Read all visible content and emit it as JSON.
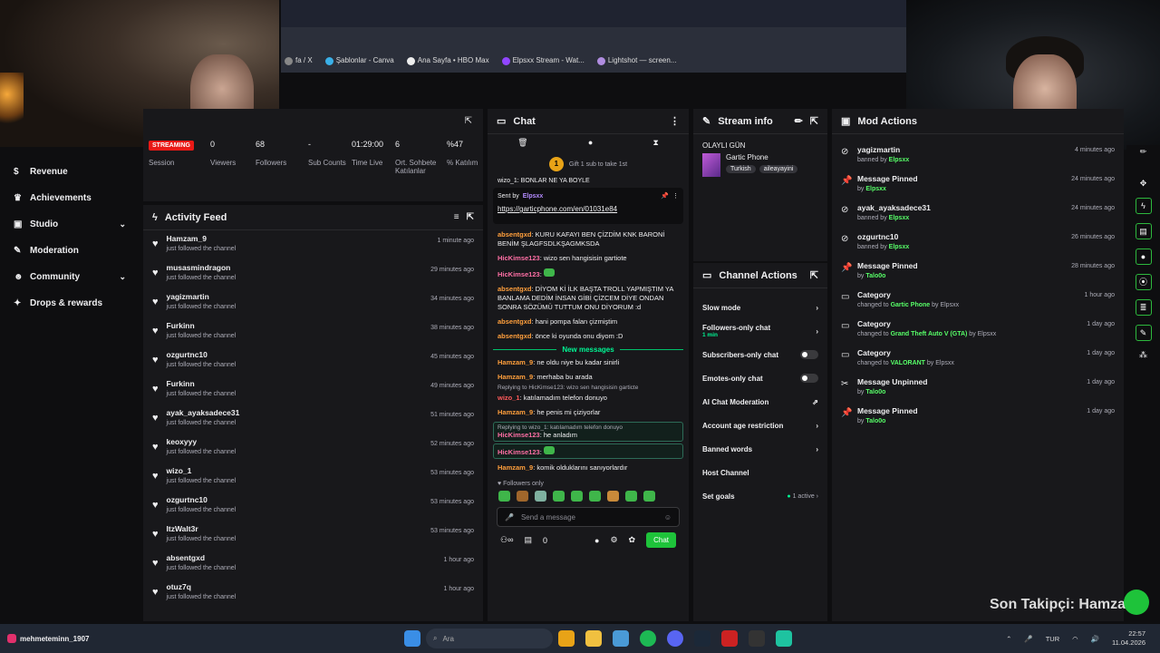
{
  "bookmarks": [
    {
      "label": "fa / X"
    },
    {
      "label": "Şablonlar - Canva"
    },
    {
      "label": "Ana Sayfa • HBO Max"
    },
    {
      "label": "Elpsxx Stream - Wat..."
    },
    {
      "label": "Lightshot — screen..."
    }
  ],
  "sidebar": {
    "items": [
      {
        "label": "Revenue",
        "icon": "dollar-icon",
        "chev": false
      },
      {
        "label": "Achievements",
        "icon": "trophy-icon",
        "chev": false
      },
      {
        "label": "Studio",
        "icon": "film-icon",
        "chev": true
      },
      {
        "label": "Moderation",
        "icon": "wrench-icon",
        "chev": false
      },
      {
        "label": "Community",
        "icon": "people-icon",
        "chev": true
      },
      {
        "label": "Drops & rewards",
        "icon": "gift-icon",
        "chev": false
      }
    ]
  },
  "stats": {
    "streaming_badge": "STREAMING",
    "items": [
      {
        "value": "",
        "label": "Session"
      },
      {
        "value": "0",
        "label": "Viewers"
      },
      {
        "value": "68",
        "label": "Followers"
      },
      {
        "value": "-",
        "label": "Sub Counts"
      },
      {
        "value": "01:29:00",
        "label": "Time Live"
      },
      {
        "value": "6",
        "label": "Ort. Sohbete Katılanlar"
      },
      {
        "value": "%47",
        "label": "% Katılım"
      }
    ]
  },
  "activity": {
    "title": "Activity Feed",
    "items": [
      {
        "name": "Hamzam_9",
        "sub": "just followed the channel",
        "time": "1 minute ago"
      },
      {
        "name": "musasmindragon",
        "sub": "just followed the channel",
        "time": "29 minutes ago"
      },
      {
        "name": "yagizmartin",
        "sub": "just followed the channel",
        "time": "34 minutes ago"
      },
      {
        "name": "Furkinn",
        "sub": "just followed the channel",
        "time": "38 minutes ago"
      },
      {
        "name": "ozgurtnc10",
        "sub": "just followed the channel",
        "time": "45 minutes ago"
      },
      {
        "name": "Furkinn",
        "sub": "just followed the channel",
        "time": "49 minutes ago"
      },
      {
        "name": "ayak_ayaksadece31",
        "sub": "just followed the channel",
        "time": "51 minutes ago"
      },
      {
        "name": "keoxyyy",
        "sub": "just followed the channel",
        "time": "52 minutes ago"
      },
      {
        "name": "wizo_1",
        "sub": "just followed the channel",
        "time": "53 minutes ago"
      },
      {
        "name": "ozgurtnc10",
        "sub": "just followed the channel",
        "time": "53 minutes ago"
      },
      {
        "name": "ItzWalt3r",
        "sub": "just followed the channel",
        "time": "53 minutes ago"
      },
      {
        "name": "absentgxd",
        "sub": "just followed the channel",
        "time": "1 hour ago"
      },
      {
        "name": "otuz7q",
        "sub": "just followed the channel",
        "time": "1 hour ago"
      }
    ]
  },
  "chat": {
    "title": "Chat",
    "gift": "Gift 1 sub to take 1st",
    "gift_count": "1",
    "cut_msg": "wizo_1: BONLAR NE YA BOYLE",
    "pinned_by_label": "Sent by",
    "pinned_by": "Elpsxx",
    "pinned_link": "https://garticphone.com/en/01031e84",
    "m1_user": "absentgxd",
    "m1_text": ": KURU KAFAYI BEN ÇİZDİM KNK BARONİ BENİM ŞLAGFSDLKŞAGMKSDA",
    "m2_user": "HicKimse123",
    "m2_text": ": wizo sen hangisisin gartiote",
    "m3_user": "HicKimse123",
    "m3_text": ":",
    "m4_user": "absentgxd",
    "m4_text": ": DİYOM Kİ İLK BAŞTA TROLL YAPMIŞTIM YA BANLAMA DEDİM İNSAN GİBİ ÇİZCEM DİYE ONDAN SONRA SÖZÜMÜ TUTTUM ONU DİYORUM :d",
    "m5_user": "absentgxd",
    "m5_text": ": hani pompa falan çizmiştim",
    "m6_user": "absentgxd",
    "m6_text": ": önce ki oyunda onu diyom :D",
    "new_messages": "New messages",
    "m7_user": "Hamzam_9",
    "m7_text": ": ne oldu niye bu kadar sinirli",
    "m8_user": "Hamzam_9",
    "m8_text": ": merhaba bu arada",
    "reply1": "Replying to HicKimse123: wizo sen hangisisin garticte",
    "m9_user": "wizo_1",
    "m9_text": ": katılamadım telefon donuyo",
    "m10_user": "Hamzam_9",
    "m10_text": ": he penis mi çiziyorlar",
    "reply2": "Replying to wizo_1: katılamadım telefon donuyo",
    "m11_user": "HicKimse123",
    "m11_text": ": he anladım",
    "m12_user": "HicKimse123",
    "m12_text": ":",
    "m13_user": "Hamzam_9",
    "m13_text": ": komik olduklarını sanıyorlardır",
    "followers_only": "Followers only",
    "placeholder": "Send a message",
    "points": "0",
    "chat_button": "Chat"
  },
  "streaminfo": {
    "title": "Stream info",
    "stream_title": "OLAYLI GÜN",
    "game": "Gartic Phone",
    "tags": [
      "Turkish",
      "aileayayini"
    ]
  },
  "channel_actions": {
    "title": "Channel Actions",
    "items": [
      {
        "label": "Slow mode",
        "type": "chev"
      },
      {
        "label": "Followers-only chat",
        "sub": "1 min",
        "type": "chev"
      },
      {
        "label": "Subscribers-only chat",
        "type": "toggle"
      },
      {
        "label": "Emotes-only chat",
        "type": "toggle"
      },
      {
        "label": "AI Chat Moderation",
        "type": "ext"
      },
      {
        "label": "Account age restriction",
        "type": "chev"
      },
      {
        "label": "Banned words",
        "type": "chev"
      },
      {
        "label": "Host Channel",
        "type": "none"
      },
      {
        "label": "Set goals",
        "type": "goal",
        "sub": "1 active"
      }
    ]
  },
  "mod_actions": {
    "title": "Mod Actions",
    "items": [
      {
        "icon": "ban-icon",
        "title": "yagizmartin",
        "pre": "banned by ",
        "by": "Elpsxx",
        "post": "",
        "time": "",
        "time_label": "4 minutes ago"
      },
      {
        "icon": "pin-icon",
        "title": "Message Pinned",
        "pre": "by ",
        "by": "Elpsxx",
        "post": "",
        "time_label": "24 minutes ago"
      },
      {
        "icon": "ban-icon",
        "title": "ayak_ayaksadece31",
        "pre": "banned by ",
        "by": "Elpsxx",
        "post": "",
        "time_label": "24 minutes ago"
      },
      {
        "icon": "ban-icon",
        "title": "ozgurtnc10",
        "pre": "banned by ",
        "by": "Elpsxx",
        "post": "",
        "time_label": "26 minutes ago"
      },
      {
        "icon": "pin-icon",
        "title": "Message Pinned",
        "pre": "by ",
        "by": "Talo0o",
        "post": "",
        "time_label": "28 minutes ago"
      },
      {
        "icon": "category-icon",
        "title": "Category",
        "pre": "changed to ",
        "by": "Gartic Phone",
        "post": " by Elpsxx",
        "time_label": "1 hour ago"
      },
      {
        "icon": "category-icon",
        "title": "Category",
        "pre": "changed to ",
        "by": "Grand Theft Auto V (GTA)",
        "post": " by Elpsxx",
        "time_label": "1 day ago"
      },
      {
        "icon": "category-icon",
        "title": "Category",
        "pre": "changed to ",
        "by": "VALORANT",
        "post": " by Elpsxx",
        "time_label": "1 day ago"
      },
      {
        "icon": "unpin-icon",
        "title": "Message Unpinned",
        "pre": "by ",
        "by": "Talo0o",
        "post": "",
        "time_label": "1 day ago"
      },
      {
        "icon": "pin-icon",
        "title": "Message Pinned",
        "pre": "by ",
        "by": "Talo0o",
        "post": "",
        "time_label": "1 day ago"
      }
    ]
  },
  "overlay": {
    "text": "Son Takipçi: Hamzam"
  },
  "taskbar": {
    "user": "mehmeteminn_1907",
    "search": "Ara",
    "lang": "TUR",
    "time": "22:57",
    "date": "11.04.2026"
  }
}
